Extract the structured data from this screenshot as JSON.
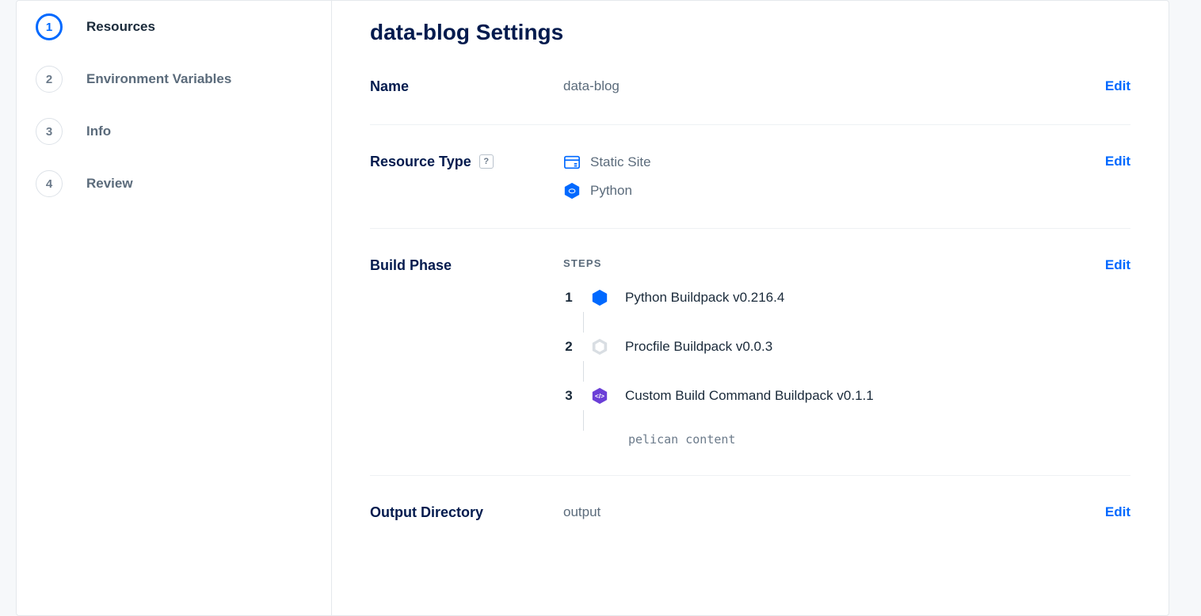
{
  "sidebar": {
    "items": [
      {
        "num": "1",
        "label": "Resources",
        "active": true
      },
      {
        "num": "2",
        "label": "Environment Variables",
        "active": false
      },
      {
        "num": "3",
        "label": "Info",
        "active": false
      },
      {
        "num": "4",
        "label": "Review",
        "active": false
      }
    ]
  },
  "main": {
    "title": "data-blog Settings",
    "edit_label": "Edit",
    "sections": {
      "name": {
        "label": "Name",
        "value": "data-blog"
      },
      "resource_type": {
        "label": "Resource Type",
        "help": "?",
        "rows": [
          {
            "icon": "static-site-icon",
            "text": "Static Site"
          },
          {
            "icon": "python-icon",
            "text": "Python"
          }
        ]
      },
      "build_phase": {
        "label": "Build Phase",
        "steps_heading": "STEPS",
        "steps": [
          {
            "num": "1",
            "icon": "python-icon",
            "name": "Python Buildpack v0.216.4"
          },
          {
            "num": "2",
            "icon": "procfile-icon",
            "name": "Procfile Buildpack v0.0.3"
          },
          {
            "num": "3",
            "icon": "custom-build-icon",
            "name": "Custom Build Command Buildpack v0.1.1",
            "command": "pelican content"
          }
        ]
      },
      "output_directory": {
        "label": "Output Directory",
        "value": "output"
      }
    }
  }
}
